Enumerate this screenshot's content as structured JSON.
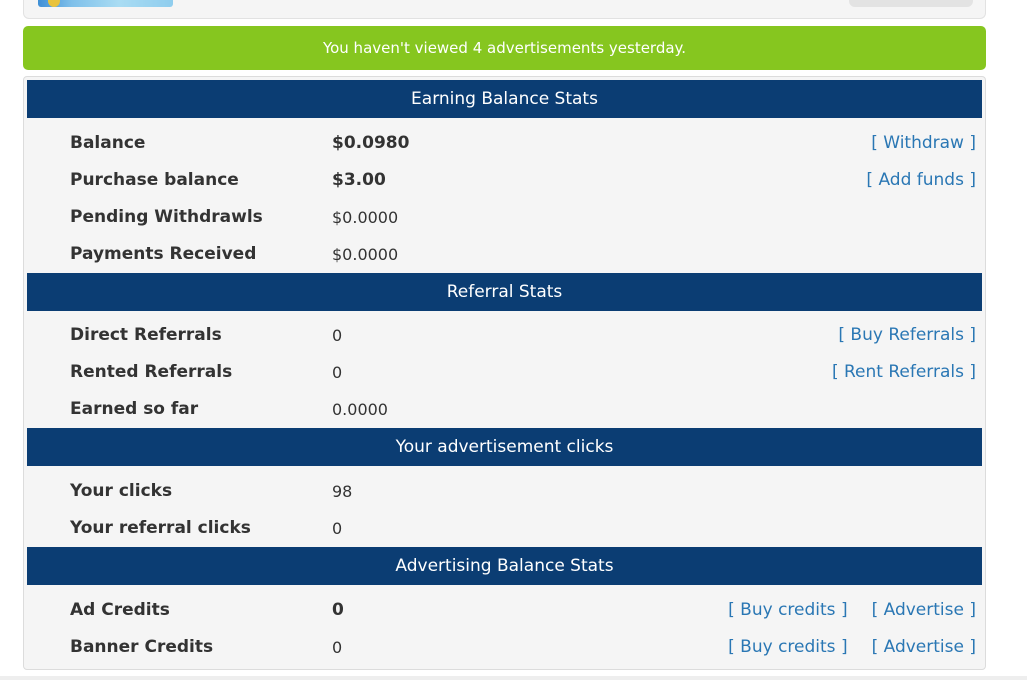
{
  "notice": {
    "text": "You haven't viewed 4 advertisements yesterday."
  },
  "colors": {
    "notice_bg": "#86c61f",
    "header_bg": "#0b3d73",
    "link": "#2a77b4",
    "panel_bg": "#f5f5f5"
  },
  "earning": {
    "title": "Earning Balance Stats",
    "rows": [
      {
        "label": "Balance",
        "value": "$0.0980",
        "action": "[ Withdraw ]"
      },
      {
        "label": "Purchase balance",
        "value": "$3.00",
        "action": "[ Add funds ]"
      },
      {
        "label": "Pending Withdrawls",
        "value": "$0.0000"
      },
      {
        "label": "Payments Received",
        "value": "$0.0000"
      }
    ]
  },
  "referral": {
    "title": "Referral Stats",
    "rows": [
      {
        "label": "Direct Referrals",
        "value": "0",
        "action": "[ Buy Referrals ]"
      },
      {
        "label": "Rented Referrals",
        "value": "0",
        "action": "[ Rent Referrals ]"
      },
      {
        "label": "Earned so far",
        "value": "0.0000"
      }
    ]
  },
  "clicks": {
    "title": "Your advertisement clicks",
    "rows": [
      {
        "label": "Your clicks",
        "value": "98"
      },
      {
        "label": "Your referral clicks",
        "value": "0"
      }
    ]
  },
  "advertising": {
    "title": "Advertising Balance Stats",
    "rows": [
      {
        "label": "Ad Credits",
        "value": "0",
        "action": "[ Buy credits ]",
        "action2": "[ Advertise ]"
      },
      {
        "label": "Banner Credits",
        "value": "0",
        "action": "[ Buy credits ]",
        "action2": "[ Advertise ]"
      }
    ]
  }
}
